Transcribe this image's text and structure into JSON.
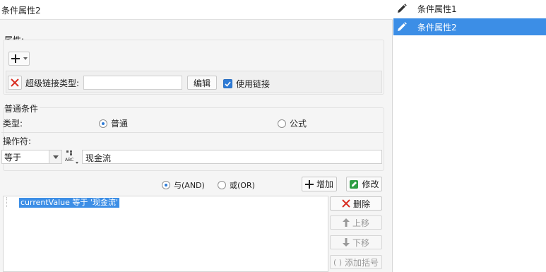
{
  "panel_title": "条件属性2",
  "properties": {
    "section_label": "属性:",
    "hyperlink_type_label": "超级链接类型:",
    "hyperlink_type_value": "",
    "edit_label": "编辑",
    "use_link_label": "使用链接",
    "use_link_checked": true
  },
  "common_condition": {
    "section_label": "普通条件",
    "type_label": "类型:",
    "type_options": [
      "普通",
      "公式"
    ],
    "type_selected": "普通",
    "operator_label": "操作符:",
    "operator_value": "等于",
    "value_text": "现金流"
  },
  "logic": {
    "and_label": "与(AND)",
    "or_label": "或(OR)",
    "selected": "与(AND)",
    "add_label": "增加",
    "modify_label": "修改"
  },
  "conditions": {
    "items": [
      "currentValue 等于 '现金流'"
    ],
    "delete_label": "删除",
    "up_label": "上移",
    "down_label": "下移",
    "add_bracket_label": "添加括号"
  },
  "conditions_list": {
    "items": [
      {
        "label": "条件属性1",
        "selected": false
      },
      {
        "label": "条件属性2",
        "selected": true
      }
    ]
  },
  "colors": {
    "accent": "#2e7bd6",
    "selected_bg": "#3c8ee6",
    "delete_red": "#d93025",
    "modify_green": "#2f9e44"
  }
}
